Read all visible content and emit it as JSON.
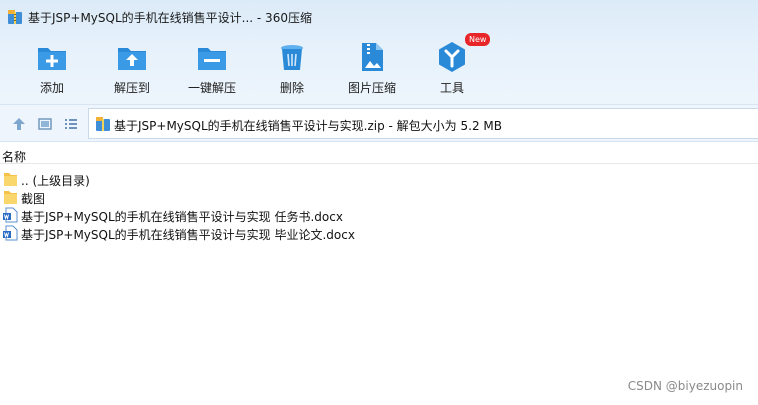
{
  "window": {
    "title": "基于JSP+MySQL的手机在线销售平设计... - 360压缩"
  },
  "toolbar": {
    "items": [
      {
        "label": "添加",
        "icon": "add-icon"
      },
      {
        "label": "解压到",
        "icon": "extract-to-icon"
      },
      {
        "label": "一键解压",
        "icon": "one-click-extract-icon"
      },
      {
        "label": "删除",
        "icon": "trash-icon"
      },
      {
        "label": "图片压缩",
        "icon": "image-compress-icon"
      },
      {
        "label": "工具",
        "icon": "tools-icon",
        "badge": "New"
      }
    ]
  },
  "address": {
    "path": "基于JSP+MySQL的手机在线销售平设计与实现.zip - 解包大小为 5.2 MB"
  },
  "list": {
    "column_name": "名称",
    "rows": [
      {
        "name": ".. (上级目录)",
        "type": "folder"
      },
      {
        "name": "截图",
        "type": "folder"
      },
      {
        "name": "基于JSP+MySQL的手机在线销售平设计与实现  任务书.docx",
        "type": "docx"
      },
      {
        "name": "基于JSP+MySQL的手机在线销售平设计与实现 毕业论文.docx",
        "type": "docx"
      }
    ]
  },
  "watermark": "CSDN @biyezuopin",
  "colors": {
    "accent": "#2b8ad8",
    "folder": "#f5c24a",
    "badge": "#e8262a"
  }
}
